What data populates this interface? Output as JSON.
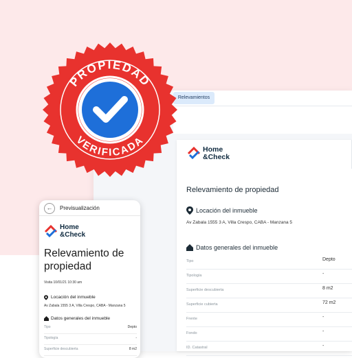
{
  "seal": {
    "top_text": "PROPIEDAD",
    "bottom_text": "VERIFICADA"
  },
  "brand": {
    "line1": "Home",
    "line2": "&Check"
  },
  "desktop": {
    "tab_label": "Relevamientos",
    "title": "Relevamiento de propiedad",
    "location_heading": "Locación del inmueble",
    "address": "Av Zabala 1555 3 A, Villa Crespo, CABA - Manzana 5",
    "general_heading": "Datos generales del inmueble",
    "rows": [
      {
        "label": "Tipo",
        "value": "Depto"
      },
      {
        "label": "Tipología",
        "value": "-"
      },
      {
        "label": "Superficie descubierta",
        "value": "8 m2"
      },
      {
        "label": "Superficie cubierta",
        "value": "72 m2"
      },
      {
        "label": "Frente",
        "value": "-"
      },
      {
        "label": "Fondo",
        "value": "-"
      },
      {
        "label": "ID. Catastral",
        "value": "-"
      }
    ]
  },
  "mobile": {
    "header": "Previsualización",
    "title_line1": "Relevamiento de",
    "title_line2": "propiedad",
    "visit": "Visita 10/01/21 10:30 am",
    "location_heading": "Locación del inmueble",
    "address": "Av Zabala 1555 3 A, Villa Crespo, CABA - Manzana 5",
    "general_heading": "Datos generales del inmueble",
    "rows": [
      {
        "label": "Tipo",
        "value": "Depto"
      },
      {
        "label": "Tipología",
        "value": "-"
      },
      {
        "label": "Superficie descubierta",
        "value": "8 m2"
      }
    ]
  },
  "colors": {
    "seal_red": "#e8322e",
    "check_blue": "#1e6fd9",
    "pink_bg": "#fde9ea"
  }
}
